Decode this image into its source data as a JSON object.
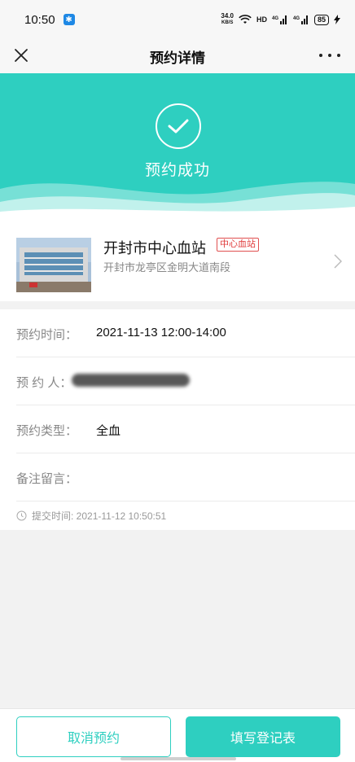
{
  "status_bar": {
    "time": "10:50",
    "app_icon": "bluetooth-icon",
    "net_speed": "34.0",
    "net_speed_unit": "KB/S",
    "signal_label": "HD",
    "battery": "85"
  },
  "nav": {
    "title": "预约详情",
    "close_icon": "close-icon",
    "more_icon": "more-icon"
  },
  "hero": {
    "status_text": "预约成功",
    "icon": "check-circle-icon"
  },
  "station": {
    "name": "开封市中心血站",
    "badge": "中心血站",
    "address": "开封市龙亭区金明大道南段"
  },
  "details": {
    "rows": [
      {
        "label": "预约时间：",
        "value": "2021-11-13 12:00-14:00"
      },
      {
        "label": "预  约 人：",
        "value": ""
      },
      {
        "label": "预约类型：",
        "value": "全血"
      },
      {
        "label": "备注留言：",
        "value": ""
      }
    ],
    "submit_time": "提交时间: 2021-11-12 10:50:51"
  },
  "actions": {
    "cancel": "取消预约",
    "fill_form": "填写登记表"
  },
  "colors": {
    "accent": "#2ecfc0",
    "badge_red": "#e03a3a"
  }
}
